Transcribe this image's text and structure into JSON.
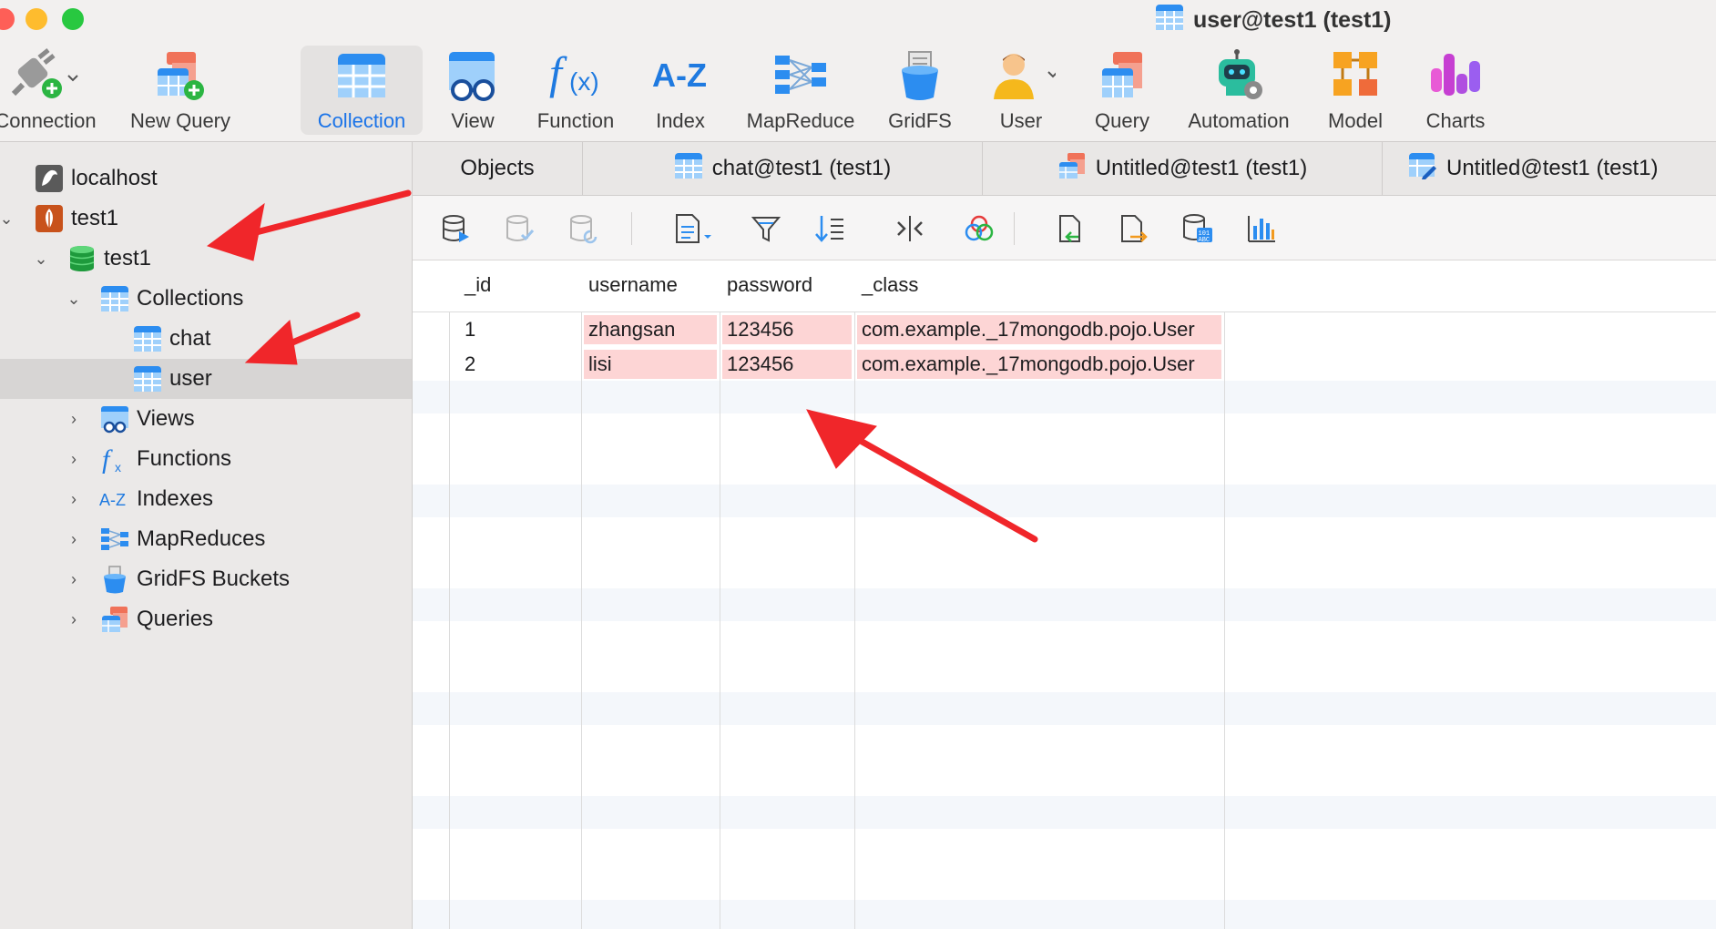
{
  "window": {
    "title": "user@test1 (test1)"
  },
  "toolbar": {
    "items": [
      {
        "label": "Connection",
        "icon": "connection-plug-icon"
      },
      {
        "label": "New Query",
        "icon": "new-query-icon"
      },
      {
        "label": "Collection",
        "icon": "collection-table-icon",
        "active": true
      },
      {
        "label": "View",
        "icon": "view-glasses-icon"
      },
      {
        "label": "Function",
        "icon": "function-fx-icon"
      },
      {
        "label": "Index",
        "icon": "index-az-icon"
      },
      {
        "label": "MapReduce",
        "icon": "mapreduce-icon"
      },
      {
        "label": "GridFS",
        "icon": "gridfs-bucket-icon"
      },
      {
        "label": "User",
        "icon": "user-person-icon"
      },
      {
        "label": "Query",
        "icon": "query-icon"
      },
      {
        "label": "Automation",
        "icon": "automation-robot-icon"
      },
      {
        "label": "Model",
        "icon": "model-icon"
      },
      {
        "label": "Charts",
        "icon": "charts-icon"
      }
    ]
  },
  "sidebar": {
    "items": [
      {
        "label": "localhost",
        "icon": "mysql-dolphin-icon"
      },
      {
        "label": "test1",
        "icon": "mongodb-leaf-icon"
      },
      {
        "label": "test1",
        "icon": "database-cylinder-icon"
      },
      {
        "label": "Collections",
        "icon": "collections-icon"
      },
      {
        "label": "chat",
        "icon": "collection-icon"
      },
      {
        "label": "user",
        "icon": "collection-icon",
        "selected": true
      },
      {
        "label": "Views",
        "icon": "views-icon"
      },
      {
        "label": "Functions",
        "icon": "functions-icon"
      },
      {
        "label": "Indexes",
        "icon": "indexes-icon"
      },
      {
        "label": "MapReduces",
        "icon": "mapreduces-icon"
      },
      {
        "label": "GridFS Buckets",
        "icon": "gridfs-icon"
      },
      {
        "label": "Queries",
        "icon": "queries-icon"
      }
    ]
  },
  "tabs": [
    {
      "label": "Objects"
    },
    {
      "label": "chat@test1 (test1)"
    },
    {
      "label": "Untitled@test1 (test1)"
    },
    {
      "label": "Untitled@test1 (test1)"
    }
  ],
  "table": {
    "columns": [
      "_id",
      "username",
      "password",
      "_class"
    ],
    "rows": [
      [
        "1",
        "zhangsan",
        "123456",
        "com.example._17mongodb.pojo.User"
      ],
      [
        "2",
        "lisi",
        "123456",
        "com.example._17mongodb.pojo.User"
      ]
    ]
  },
  "colors": {
    "accent": "#1a73e8",
    "annotation": "#f0262a",
    "highlight_cell": "#fdd5d5"
  }
}
